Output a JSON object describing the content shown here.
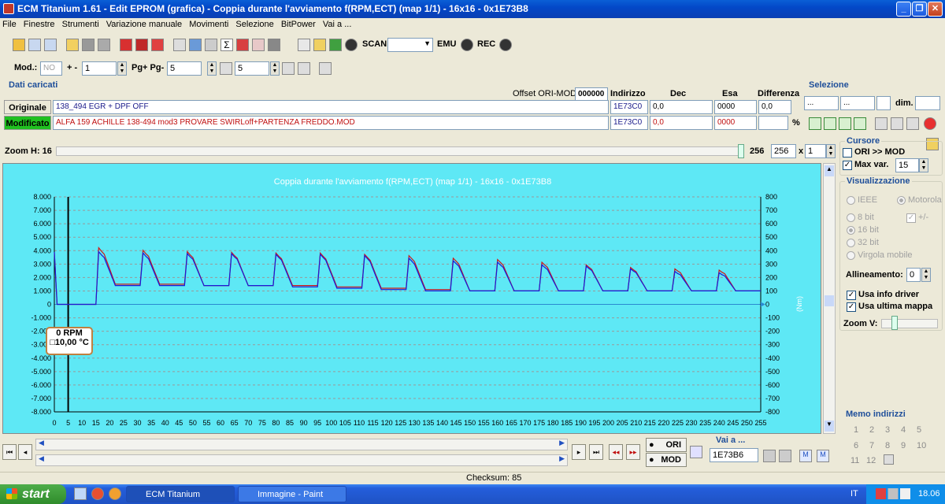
{
  "window": {
    "title": "ECM Titanium 1.61 - Edit EPROM (grafica) - Coppia durante l'avviamento f(RPM,ECT) (map 1/1) - 16x16 - 0x1E73B8"
  },
  "menu": [
    "File",
    "Finestre",
    "Strumenti",
    "Variazione manuale",
    "Movimenti",
    "Selezione",
    "BitPower",
    "Vai a ..."
  ],
  "toolbar1": {
    "scan_label": "SCAN",
    "emu_label": "EMU",
    "rec_label": "REC"
  },
  "toolbar2": {
    "mod_label": "Mod.:",
    "mod_value": "NO",
    "plusminus_label": "+ -",
    "plusminus_value": "1",
    "pg_label": "Pg+ Pg-",
    "pg_value": "5",
    "p_value": "5"
  },
  "dati": {
    "title": "Dati caricati",
    "offset_label": "Offset ORI-MOD",
    "offset_value": "000000",
    "col_indirizzo": "Indirizzo",
    "col_dec": "Dec",
    "col_esa": "Esa",
    "col_diff": "Differenza",
    "originale": {
      "label": "Originale",
      "name": "138_494 EGR + DPF OFF",
      "indirizzo": "1E73C0",
      "dec": "0,0",
      "esa": "0000",
      "diff": "0,0"
    },
    "modificato": {
      "label": "Modificato",
      "name": "ALFA 159 ACHILLE 138-494 mod3 PROVARE  SWIRLoff+PARTENZA FREDDO.MOD",
      "indirizzo": "1E73C0",
      "dec": "0,0",
      "esa": "0000",
      "diff": "",
      "pct": "%"
    }
  },
  "selezione": {
    "title": "Selezione",
    "field1": "...",
    "field2": "...",
    "dim_label": "dim."
  },
  "zoom": {
    "label": "Zoom H: 16",
    "value_text": "256",
    "value_field": "256",
    "x_label": "x",
    "mult": "1"
  },
  "cursore": {
    "title": "Cursore",
    "ori_mod": "ORI >> MOD",
    "max_var": "Max var.",
    "max_var_value": "15"
  },
  "visualizzazione": {
    "title": "Visualizzazione",
    "ieee": "IEEE",
    "motorola": "Motorola",
    "bit8": "8 bit",
    "plusminus": "+/-",
    "bit16": "16 bit",
    "bit32": "32 bit",
    "virgola": "Virgola mobile",
    "allineamento_label": "Allineamento:",
    "allineamento_value": "0",
    "usa_info": "Usa info driver",
    "usa_ultima": "Usa ultima mappa",
    "zoomv": "Zoom V:"
  },
  "memo": {
    "title": "Memo indirizzi",
    "numbers": [
      "1",
      "2",
      "3",
      "4",
      "5",
      "6",
      "7",
      "8",
      "9",
      "10",
      "11",
      "12"
    ]
  },
  "vaia": {
    "title": "Vai a ...",
    "value": "1E73B6",
    "ori": "ORI",
    "mod": "MOD"
  },
  "status": {
    "checksum": "Checksum: 85"
  },
  "tooltip": {
    "rpm": "0 RPM",
    "temp": "10,00 °C"
  },
  "taskbar": {
    "start": "start",
    "task1": "ECM Titanium",
    "task2": "Immagine - Paint",
    "lang": "IT",
    "clock": "18.06"
  },
  "chart_data": {
    "type": "line",
    "title": "Coppia durante l'avviamento f(RPM,ECT) (map 1/1) - 16x16 - 0x1E73B8",
    "xlabel": "",
    "ylabel": "",
    "y2label": "(Nm)",
    "xlim": [
      0,
      255
    ],
    "ylim": [
      -8000,
      8000
    ],
    "y2lim": [
      -800,
      800
    ],
    "x_ticks": [
      0,
      5,
      10,
      15,
      20,
      25,
      30,
      35,
      40,
      45,
      50,
      55,
      60,
      65,
      70,
      75,
      80,
      85,
      90,
      95,
      100,
      105,
      110,
      115,
      120,
      125,
      130,
      135,
      140,
      145,
      150,
      155,
      160,
      165,
      170,
      175,
      180,
      185,
      190,
      195,
      200,
      205,
      210,
      215,
      220,
      225,
      230,
      235,
      240,
      245,
      250,
      255
    ],
    "y_ticks": [
      "8.000",
      "7.000",
      "6.000",
      "5.000",
      "4.000",
      "3.000",
      "2.000",
      "1.000",
      "0",
      "-1.000",
      "-2.000",
      "-3.000",
      "-4.000",
      "-5.000",
      "-6.000",
      "-7.000",
      "-8.000"
    ],
    "y2_ticks": [
      "800",
      "700",
      "600",
      "500",
      "400",
      "300",
      "200",
      "100",
      "0",
      "-100",
      "-200",
      "-300",
      "-400",
      "-500",
      "-600",
      "-700",
      "-800"
    ],
    "grid": true,
    "cursor_x": 5,
    "series": [
      {
        "color": "#d01818",
        "peaks": [
          4300,
          4100,
          4000,
          3950,
          3900,
          3900,
          3800,
          3700,
          3500,
          3400,
          3200,
          3000,
          2800,
          2700,
          2600,
          2500
        ],
        "troughs": [
          1500,
          1500,
          1400,
          1400,
          1400,
          1300,
          1200,
          1100,
          1000,
          1000,
          1000,
          1000,
          1000,
          1000,
          1000,
          1000
        ]
      },
      {
        "color": "#1a1ad8",
        "peaks": [
          4000,
          3900,
          3850,
          3850,
          3800,
          3800,
          3700,
          3500,
          3300,
          3200,
          3000,
          2900,
          2700,
          2500,
          2400,
          2300
        ],
        "troughs": [
          1400,
          1400,
          1400,
          1400,
          1300,
          1200,
          1100,
          1000,
          1000,
          1000,
          1000,
          1000,
          1000,
          1000,
          1000,
          1000
        ]
      }
    ]
  }
}
